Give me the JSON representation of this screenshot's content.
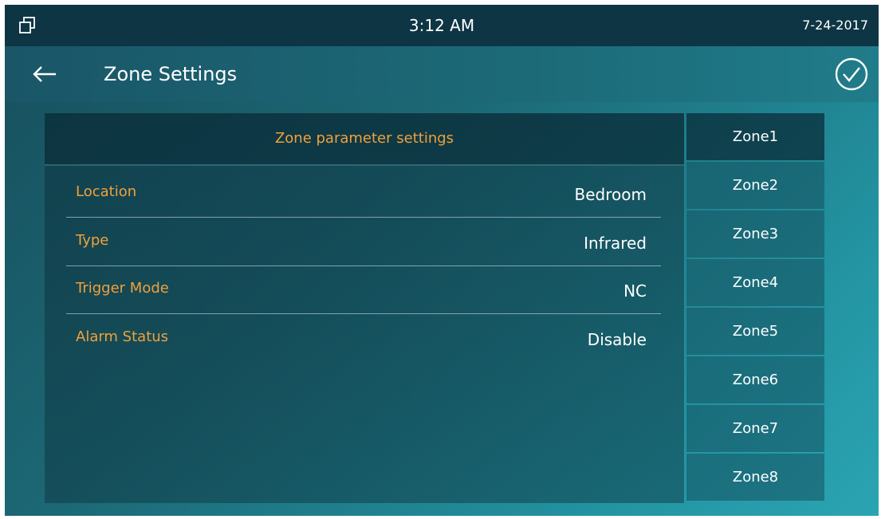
{
  "status_bar": {
    "time": "3:12 AM",
    "date": "7-24-2017"
  },
  "title_bar": {
    "title": "Zone Settings"
  },
  "panel": {
    "header": "Zone parameter settings",
    "rows": [
      {
        "label": "Location",
        "value": "Bedroom"
      },
      {
        "label": "Type",
        "value": "Infrared"
      },
      {
        "label": "Trigger Mode",
        "value": "NC"
      },
      {
        "label": "Alarm Status",
        "value": "Disable"
      }
    ]
  },
  "zones": [
    {
      "label": "Zone1",
      "selected": true
    },
    {
      "label": "Zone2",
      "selected": false
    },
    {
      "label": "Zone3",
      "selected": false
    },
    {
      "label": "Zone4",
      "selected": false
    },
    {
      "label": "Zone5",
      "selected": false
    },
    {
      "label": "Zone6",
      "selected": false
    },
    {
      "label": "Zone7",
      "selected": false
    },
    {
      "label": "Zone8",
      "selected": false
    }
  ],
  "colors": {
    "accent_label": "#f2a03a",
    "status_bar_bg": "#0e3544"
  },
  "icons": {
    "window": "multi-window-icon",
    "back": "back-arrow-icon",
    "confirm": "check-circle-icon"
  }
}
